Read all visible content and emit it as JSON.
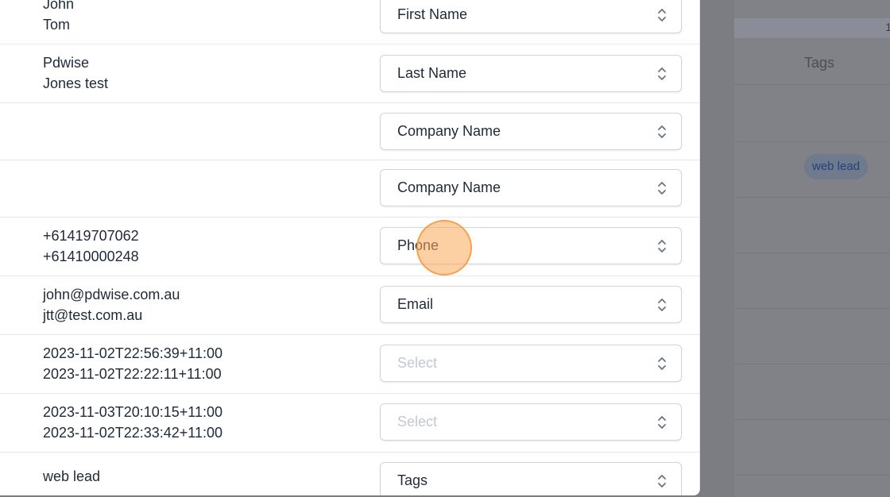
{
  "background": {
    "bar_number": "1",
    "tags_header": "Tags",
    "badge": "web lead"
  },
  "rows": [
    {
      "values": [
        "John",
        "Tom"
      ],
      "select": {
        "value": "First Name",
        "placeholder": false
      }
    },
    {
      "values": [
        "Pdwise",
        "Jones test"
      ],
      "select": {
        "value": "Last Name",
        "placeholder": false
      }
    },
    {
      "values": [],
      "select": {
        "value": "Company Name",
        "placeholder": false
      }
    },
    {
      "values": [],
      "select": {
        "value": "Company Name",
        "placeholder": false
      }
    },
    {
      "values": [
        "+61419707062",
        "+61410000248"
      ],
      "select": {
        "value": "Phone",
        "placeholder": false
      }
    },
    {
      "values": [
        "john@pdwise.com.au",
        "jtt@test.com.au"
      ],
      "select": {
        "value": "Email",
        "placeholder": false
      }
    },
    {
      "values": [
        "2023-11-02T22:56:39+11:00",
        "2023-11-02T22:22:11+11:00"
      ],
      "select": {
        "value": "Select",
        "placeholder": true
      }
    },
    {
      "values": [
        "2023-11-03T20:10:15+11:00",
        "2023-11-02T22:33:42+11:00"
      ],
      "select": {
        "value": "Select",
        "placeholder": true
      }
    },
    {
      "values": [
        "web lead"
      ],
      "select": {
        "value": "Tags",
        "placeholder": false
      }
    }
  ]
}
